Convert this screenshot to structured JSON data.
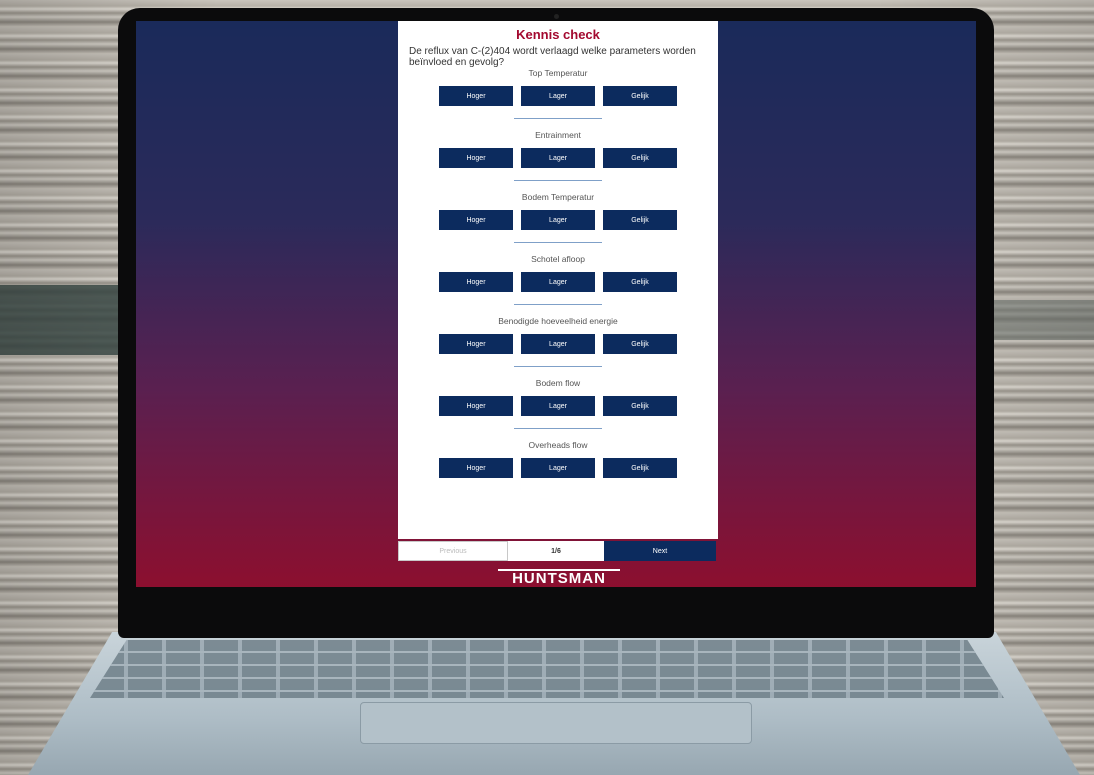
{
  "quiz": {
    "title": "Kennis check",
    "question": "De reflux van C-(2)404 wordt verlaagd welke parameters worden beïnvloed en gevolg?",
    "parameters": [
      {
        "label": "Top Temperatur",
        "options": [
          "Hoger",
          "Lager",
          "Gelijk"
        ]
      },
      {
        "label": "Entrainment",
        "options": [
          "Hoger",
          "Lager",
          "Gelijk"
        ]
      },
      {
        "label": "Bodem Temperatur",
        "options": [
          "Hoger",
          "Lager",
          "Gelijk"
        ]
      },
      {
        "label": "Schotel afloop",
        "options": [
          "Hoger",
          "Lager",
          "Gelijk"
        ]
      },
      {
        "label": "Benodigde hoeveelheid energie",
        "options": [
          "Hoger",
          "Lager",
          "Gelijk"
        ]
      },
      {
        "label": "Bodem flow",
        "options": [
          "Hoger",
          "Lager",
          "Gelijk"
        ]
      },
      {
        "label": "Overheads flow",
        "options": [
          "Hoger",
          "Lager",
          "Gelijk"
        ]
      }
    ]
  },
  "navigation": {
    "previous_label": "Previous",
    "page_indicator": "1/6",
    "next_label": "Next"
  },
  "brand": {
    "logo_text": "HUNTSMAN"
  },
  "colors": {
    "accent_title": "#a3092f",
    "button_bg": "#0c2b5e",
    "screen_top": "#1a2a5a",
    "screen_bottom": "#8c0f2f"
  }
}
